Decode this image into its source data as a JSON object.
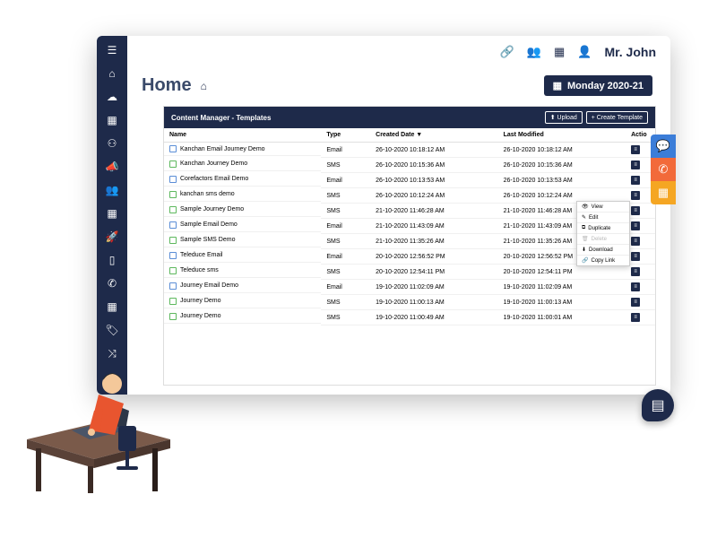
{
  "topbar": {
    "user_name": "Mr. John"
  },
  "breadcrumb": {
    "title": "Home"
  },
  "date_badge": {
    "label": "Monday 2020-21"
  },
  "panel": {
    "title": "Content Manager - Templates",
    "btn_upload": "⬆ Upload",
    "btn_create": "+ Create Template",
    "columns": {
      "name": "Name",
      "type": "Type",
      "created": "Created Date ▼",
      "modified": "Last Modified",
      "action": "Actio"
    }
  },
  "rows": [
    {
      "name": "Kanchan Email Journey Demo",
      "type": "Email",
      "created": "26-10-2020 10:18:12 AM",
      "modified": "26-10-2020 10:18:12 AM"
    },
    {
      "name": "Kanchan Journey Demo",
      "type": "SMS",
      "created": "26-10-2020 10:15:36 AM",
      "modified": "26-10-2020 10:15:36 AM"
    },
    {
      "name": "Corefactors Email Demo",
      "type": "Email",
      "created": "26-10-2020 10:13:53 AM",
      "modified": "26-10-2020 10:13:53 AM"
    },
    {
      "name": "kanchan sms demo",
      "type": "SMS",
      "created": "26-10-2020 10:12:24 AM",
      "modified": "26-10-2020 10:12:24 AM"
    },
    {
      "name": "Sample Journey Demo",
      "type": "SMS",
      "created": "21-10-2020 11:46:28 AM",
      "modified": "21-10-2020 11:46:28 AM"
    },
    {
      "name": "Sample Email Demo",
      "type": "Email",
      "created": "21-10-2020 11:43:09 AM",
      "modified": "21-10-2020 11:43:09 AM"
    },
    {
      "name": "Sample SMS Demo",
      "type": "SMS",
      "created": "21-10-2020 11:35:26 AM",
      "modified": "21-10-2020 11:35:26 AM"
    },
    {
      "name": "Teleduce Email",
      "type": "Email",
      "created": "20-10-2020 12:56:52 PM",
      "modified": "20-10-2020 12:56:52 PM"
    },
    {
      "name": "Teleduce sms",
      "type": "SMS",
      "created": "20-10-2020 12:54:11 PM",
      "modified": "20-10-2020 12:54:11 PM"
    },
    {
      "name": "Journey Email Demo",
      "type": "Email",
      "created": "19-10-2020 11:02:09 AM",
      "modified": "19-10-2020 11:02:09 AM"
    },
    {
      "name": "Journey Demo",
      "type": "SMS",
      "created": "19-10-2020 11:00:13 AM",
      "modified": "19-10-2020 11:00:13 AM"
    },
    {
      "name": "Journey Demo",
      "type": "SMS",
      "created": "19-10-2020 11:00:49 AM",
      "modified": "19-10-2020 11:00:01 AM"
    }
  ],
  "context_menu": {
    "view": "View",
    "edit": "Edit",
    "duplicate": "Duplicate",
    "delete": "Delete",
    "download": "Download",
    "copy": "Copy Link"
  }
}
